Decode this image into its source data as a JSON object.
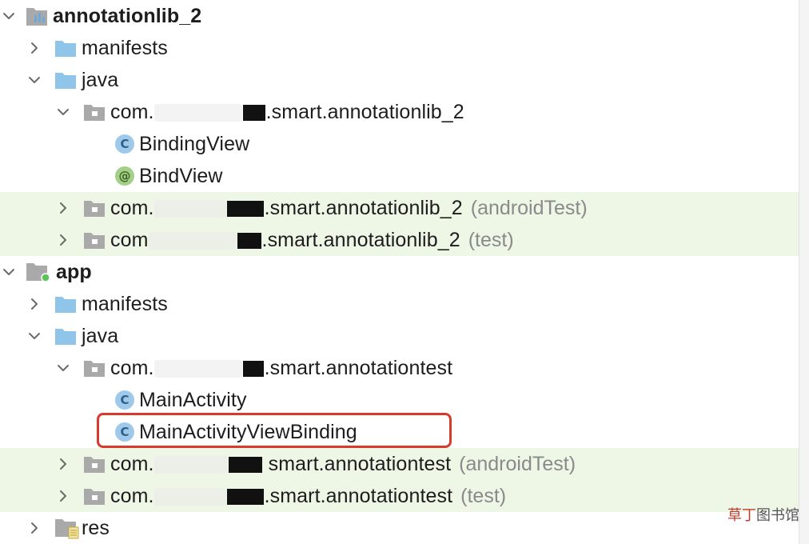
{
  "tree": {
    "module1": {
      "name": "annotationlib_2"
    },
    "manifests1": "manifests",
    "java1": "java",
    "pkg1": {
      "prefix": "com.",
      "suffix": ".smart.annotationlib_2"
    },
    "class1": "BindingView",
    "annotation1": "BindView",
    "pkg2": {
      "prefix": "com.",
      "suffix": ".smart.annotationlib_2",
      "tag": "(androidTest)"
    },
    "pkg3": {
      "prefix": "com",
      "suffix": ".smart.annotationlib_2",
      "tag": "(test)"
    },
    "module2": {
      "name": "app"
    },
    "manifests2": "manifests",
    "java2": "java",
    "pkg4": {
      "prefix": "com.",
      "suffix": ".smart.annotationtest"
    },
    "class2": "MainActivity",
    "class3": "MainActivityViewBinding",
    "pkg5": {
      "prefix": "com.",
      "suffix": " smart.annotationtest",
      "tag": "(androidTest)"
    },
    "pkg6": {
      "prefix": "com.",
      "suffix": ".smart.annotationtest",
      "tag": "(test)"
    },
    "res": "res"
  },
  "icons": {
    "class_letter": "C",
    "annotation_letter": "@"
  },
  "colors": {
    "test_row_bg": "#eef6e6",
    "highlight_border": "#d83a2c",
    "folder_blue": "#8ec5e8",
    "package_gray": "#a9a9a9"
  },
  "watermark": {
    "accent": "草丁",
    "rest": "图书馆"
  }
}
